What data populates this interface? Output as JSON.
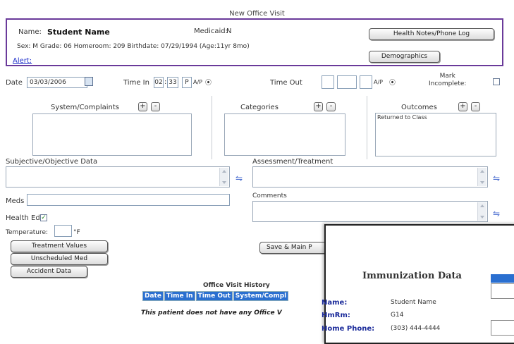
{
  "page": {
    "title": "New Office Visit"
  },
  "student": {
    "name_label": "Name:",
    "name_value": "Student Name",
    "medicaid_label": "Medicaid:",
    "medicaid_value": "N",
    "details": "Sex: M   Grade: 06   Homeroom: 209   Birthdate: 07/29/1994 (Age:11yr 8mo)",
    "alert_link": "Alert:"
  },
  "buttons": {
    "health_notes": "Health Notes/Phone Log",
    "demographics": "Demographics",
    "treatment_values": "Treatment Values",
    "unscheduled_med": "Unscheduled Med",
    "accident_data": "Accident Data",
    "save_main": "Save & Main P"
  },
  "visit": {
    "date_label": "Date",
    "date_value": "03/03/2006",
    "time_in_label": "Time In",
    "time_in_hour": "02",
    "time_in_min": "33",
    "time_in_ampm": "P",
    "ampm_hint": "A/P",
    "time_out_label": "Time Out",
    "mark_incomplete_label": "Mark\nIncomplete:"
  },
  "panels": {
    "system_complaints": "System/Complaints",
    "categories": "Categories",
    "outcomes": "Outcomes",
    "outcomes_items": [
      "Returned to Class"
    ]
  },
  "fields": {
    "subjective_label": "Subjective/Objective Data",
    "assessment_label": "Assessment/Treatment",
    "comments_label": "Comments",
    "meds_label": "Meds",
    "health_ed_label": "Health Ed:",
    "temperature_label": "Temperature:",
    "temperature_unit": "°F"
  },
  "history": {
    "title": "Office Visit History",
    "columns": [
      "Date",
      "Time In",
      "Time Out",
      "System/Compl"
    ],
    "empty_message": "This patient does not have any Office V"
  },
  "immunization_popup": {
    "title": "Immunization Data",
    "rows": [
      {
        "label": "Name:",
        "value": "Student Name"
      },
      {
        "label": "HmRm:",
        "value": "G14"
      },
      {
        "label": "Home Phone:",
        "value": "(303) 444-4444"
      }
    ]
  }
}
